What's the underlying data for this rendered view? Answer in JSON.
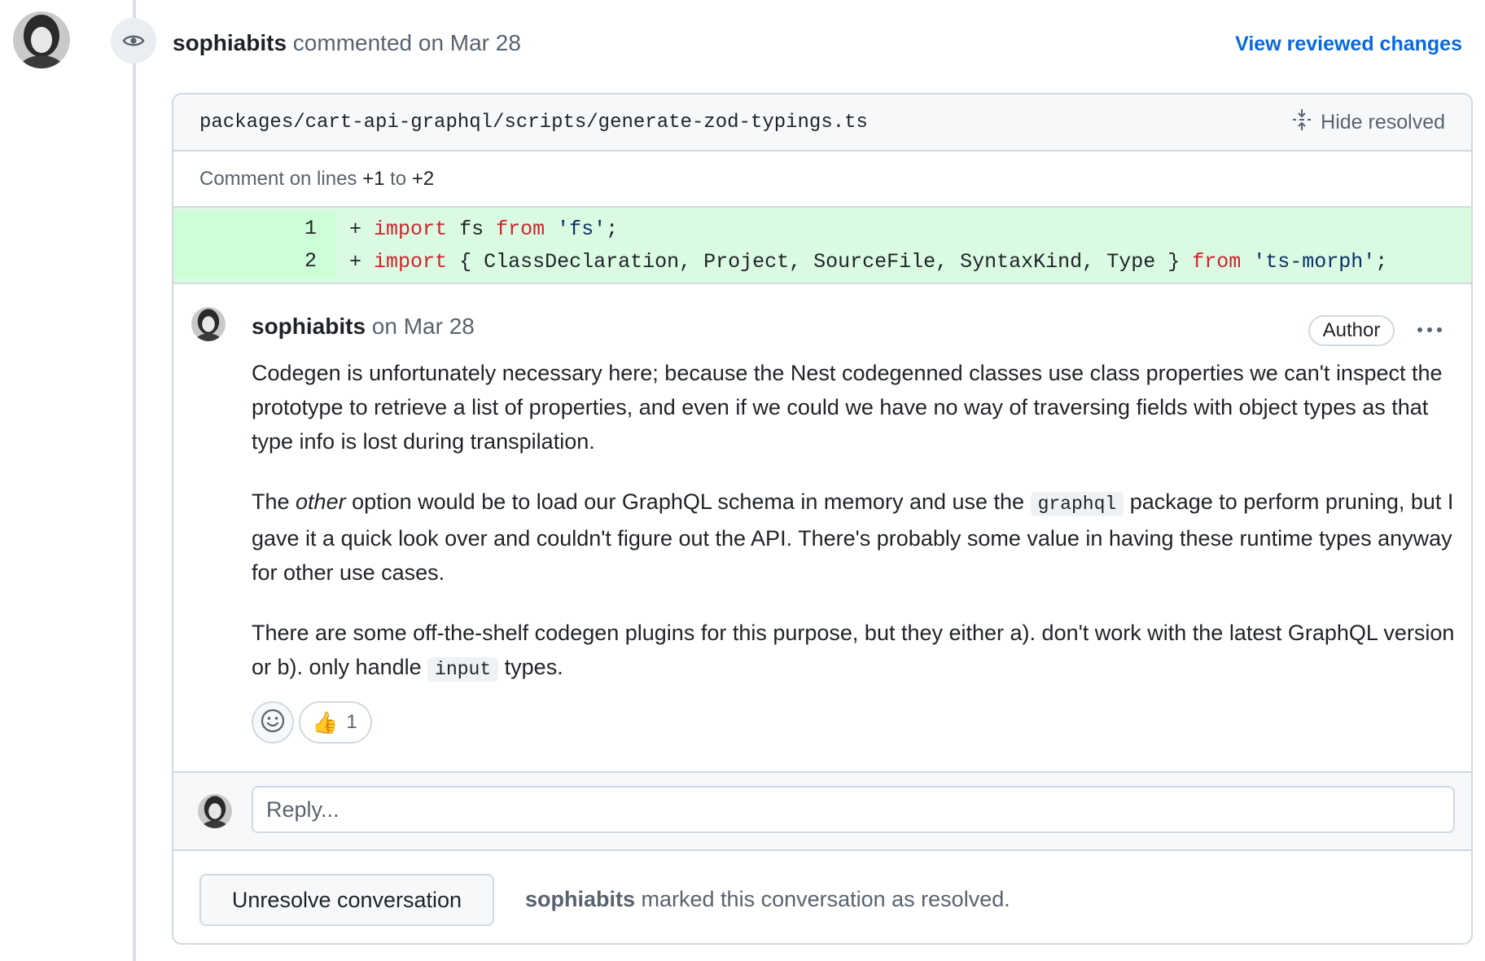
{
  "header": {
    "username": "sophiabits",
    "action": "commented on Mar 28",
    "view_changes_label": "View reviewed changes"
  },
  "file": {
    "path": "packages/cart-api-graphql/scripts/generate-zod-typings.ts",
    "hide_resolved_label": "Hide resolved"
  },
  "comment_lines": {
    "prefix": "Comment on lines",
    "start": "+1",
    "to": "to",
    "end": "+2"
  },
  "diff": {
    "lines": [
      {
        "num": "1",
        "sign": "+",
        "kw1": "import",
        "mid": "fs",
        "kw2": "from",
        "str": "'fs'",
        "end": ";"
      },
      {
        "num": "2",
        "sign": "+",
        "kw1": "import",
        "mid": "{ ClassDeclaration, Project, SourceFile, SyntaxKind, Type }",
        "kw2": "from",
        "str": "'ts-morph'",
        "end": ";"
      }
    ]
  },
  "comment": {
    "username": "sophiabits",
    "date": "on Mar 28",
    "badge": "Author",
    "p1": "Codegen is unfortunately necessary here; because the Nest codegenned classes use class properties we can't inspect the prototype to retrieve a list of properties, and even if we could we have no way of traversing fields with object types as that type info is lost during transpilation.",
    "p2_a": "The ",
    "p2_em": "other",
    "p2_b": " option would be to load our GraphQL schema in memory and use the ",
    "p2_code": "graphql",
    "p2_c": " package to perform pruning, but I gave it a quick look over and couldn't figure out the API. There's probably some value in having these runtime types anyway for other use cases.",
    "p3_a": "There are some off-the-shelf codegen plugins for this purpose, but they either a). don't work with the latest GraphQL version or b). only handle ",
    "p3_code": "input",
    "p3_b": " types.",
    "reaction_emoji": "👍",
    "reaction_count": "1"
  },
  "reply": {
    "placeholder": "Reply..."
  },
  "resolved": {
    "button_label": "Unresolve conversation",
    "username": "sophiabits",
    "message": " marked this conversation as resolved."
  },
  "colors": {
    "link": "#0969da",
    "diff_added_bg": "#dafbe1",
    "keyword": "#cf222e",
    "string": "#0a3069"
  },
  "icons": [
    "eye-icon",
    "unfold-icon",
    "kebab-horizontal-icon",
    "smiley-icon",
    "thumbs-up-icon"
  ]
}
